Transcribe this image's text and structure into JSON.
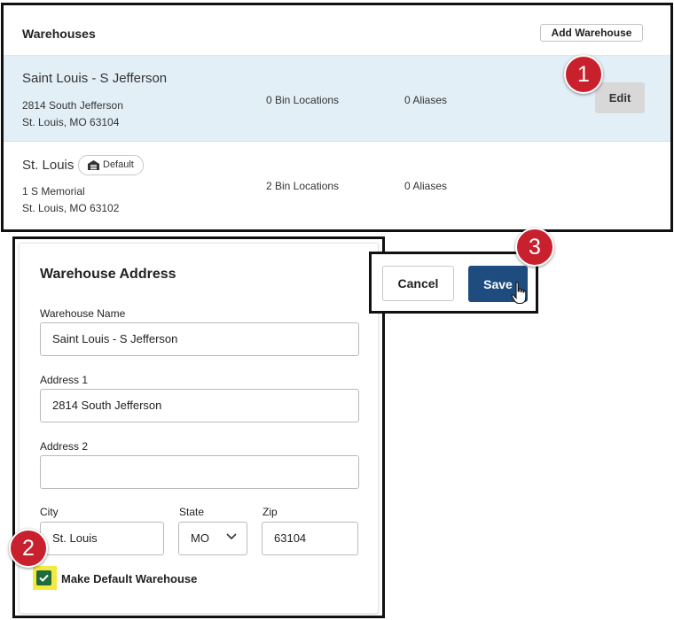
{
  "warehouses_panel": {
    "title": "Warehouses",
    "add_button_label": "Add Warehouse",
    "rows": [
      {
        "name": "Saint Louis - S Jefferson",
        "address_line1": "2814 South Jefferson",
        "address_line2": "St. Louis, MO 63104",
        "bin_locations": "0 Bin Locations",
        "aliases": "0 Aliases",
        "edit_label": "Edit",
        "selected": true
      },
      {
        "name": "St. Louis",
        "badge_label": "Default",
        "badge_icon": "warehouse-icon",
        "address_line1": "1 S Memorial",
        "address_line2": "St. Louis, MO 63102",
        "bin_locations": "2 Bin Locations",
        "aliases": "0 Aliases"
      }
    ]
  },
  "address_form": {
    "title": "Warehouse Address",
    "warehouse_name_label": "Warehouse Name",
    "warehouse_name_value": "Saint Louis - S Jefferson",
    "address1_label": "Address 1",
    "address1_value": "2814 South Jefferson",
    "address2_label": "Address 2",
    "address2_value": "",
    "city_label": "City",
    "city_value": "St. Louis",
    "state_label": "State",
    "state_value": "MO",
    "zip_label": "Zip",
    "zip_value": "63104",
    "make_default_label": "Make Default Warehouse",
    "make_default_checked": true
  },
  "actions": {
    "cancel_label": "Cancel",
    "save_label": "Save"
  },
  "callouts": [
    "1",
    "2",
    "3"
  ],
  "colors": {
    "selected_row_bg": "#e3eff7",
    "save_button_bg": "#1f4c7e",
    "callout_red": "#c8202d",
    "checkbox_green": "#1f6b3b",
    "highlight_yellow": "#f2ea3e"
  }
}
